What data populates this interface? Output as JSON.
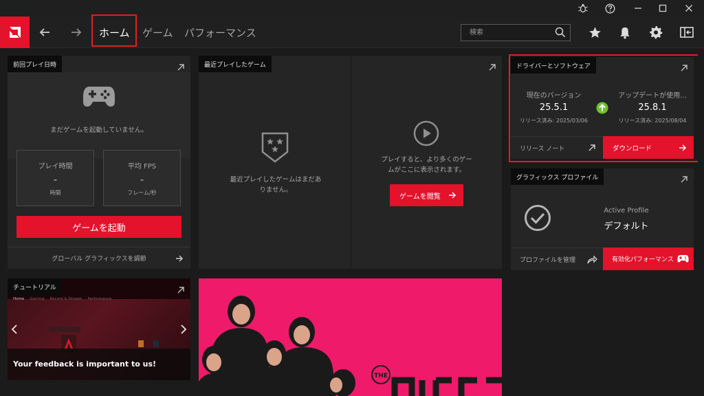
{
  "navbar": {
    "tabs": [
      {
        "label": "ホーム"
      },
      {
        "label": "ゲーム"
      },
      {
        "label": "パフォーマンス"
      }
    ],
    "search": {
      "placeholder": "検索"
    }
  },
  "last_played": {
    "title": "前回プレイ日時",
    "empty_text": "まだゲームを起動していません。",
    "stats": [
      {
        "label": "プレイ時間",
        "value": "-",
        "unit": "時間"
      },
      {
        "label": "平均 FPS",
        "value": "-",
        "unit": "フレーム/秒"
      }
    ],
    "launch_label": "ゲームを起動",
    "footer_link": "グローバル グラフィックスを調節"
  },
  "recent_games": {
    "title": "最近プレイしたゲーム",
    "empty_text": "最近プレイしたゲームはまだありません。",
    "promo_text": "プレイすると、より多くのゲームがここに表示されます。",
    "browse_label": "ゲームを閲覧"
  },
  "driver": {
    "title": "ドライバーとソフトウェア",
    "current_label": "現在のバージョン",
    "current_version": "25.5.1",
    "current_date": "リリース済み: 2025/03/06",
    "update_label": "アップデートが使用...",
    "update_version": "25.8.1",
    "update_date": "リリース済み: 2025/08/04",
    "release_notes_label": "リリース ノート",
    "download_label": "ダウンロード"
  },
  "graphics_profile": {
    "title": "グラフィックス プロファイル",
    "active_label": "Active Profile",
    "profile_name": "デフォルト",
    "manage_label": "プロファイルを管理",
    "enable_label": "有効化パフォーマンス"
  },
  "tutorial": {
    "title": "チュートリアル",
    "tabs": [
      "Home",
      "Gaming",
      "Record & Stream",
      "Performance"
    ],
    "feedback_text": "Your feedback is important to us!"
  },
  "banner": {
    "brand_text": "THE"
  },
  "colors": {
    "accent": "#e4122b",
    "update_green": "#6fc22a",
    "banner_pink": "#ef1a6a"
  }
}
